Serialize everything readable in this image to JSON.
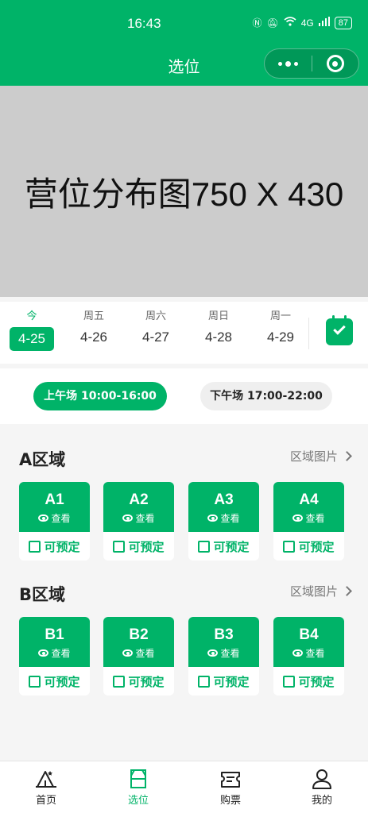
{
  "status_bar": {
    "time": "16:43",
    "signal": "4G",
    "battery": "87"
  },
  "nav": {
    "title": "选位"
  },
  "map": {
    "placeholder_text": "营位分布图750 X 430"
  },
  "dates": [
    {
      "week": "今",
      "date": "4-25",
      "active": true
    },
    {
      "week": "周五",
      "date": "4-26"
    },
    {
      "week": "周六",
      "date": "4-27"
    },
    {
      "week": "周日",
      "date": "4-28"
    },
    {
      "week": "周一",
      "date": "4-29"
    }
  ],
  "sessions": [
    {
      "label": "上午场 10:00-16:00",
      "active": true
    },
    {
      "label": "下午场 17:00-22:00"
    }
  ],
  "zones": [
    {
      "title": "A区域",
      "link": "区域图片",
      "seats": [
        {
          "code": "A1",
          "view": "查看",
          "status": "可预定"
        },
        {
          "code": "A2",
          "view": "查看",
          "status": "可预定"
        },
        {
          "code": "A3",
          "view": "查看",
          "status": "可预定"
        },
        {
          "code": "A4",
          "view": "查看",
          "status": "可预定"
        }
      ]
    },
    {
      "title": "B区域",
      "link": "区域图片",
      "seats": [
        {
          "code": "B1",
          "view": "查看",
          "status": "可预定"
        },
        {
          "code": "B2",
          "view": "查看",
          "status": "可预定"
        },
        {
          "code": "B3",
          "view": "查看",
          "status": "可预定"
        },
        {
          "code": "B4",
          "view": "查看",
          "status": "可预定"
        }
      ]
    }
  ],
  "tabs": [
    {
      "label": "首页",
      "icon": "tent-icon"
    },
    {
      "label": "选位",
      "icon": "seat-select-icon",
      "active": true
    },
    {
      "label": "购票",
      "icon": "ticket-icon"
    },
    {
      "label": "我的",
      "icon": "user-icon"
    }
  ],
  "colors": {
    "brand": "#00b368",
    "placeholder": "#cccccc"
  }
}
